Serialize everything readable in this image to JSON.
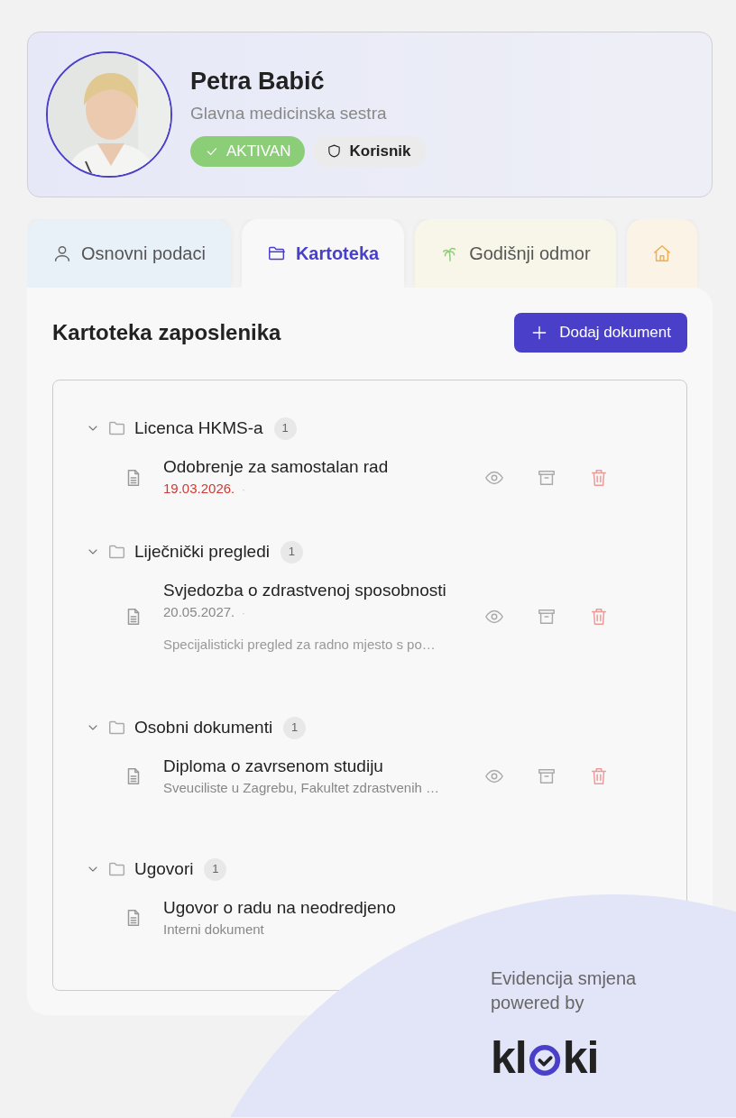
{
  "profile": {
    "name": "Petra Babić",
    "role": "Glavna medicinska sestra",
    "badges": [
      {
        "kind": "status",
        "label": "AKTIVAN"
      },
      {
        "kind": "role",
        "label": "Korisnik"
      }
    ]
  },
  "tabs": [
    {
      "kind": "person",
      "label": "Osnovni podaci",
      "selected": false,
      "color": "#e8f0f8"
    },
    {
      "kind": "folder",
      "label": "Kartoteka",
      "selected": true,
      "color": "#f8f8f8"
    },
    {
      "kind": "palm",
      "label": "Godišnji odmor",
      "selected": false,
      "color": "#f8f6e8"
    },
    {
      "kind": "house",
      "selected": false,
      "color": "#fbf4e6"
    }
  ],
  "panel": {
    "title": "Kartoteka zaposlenika",
    "add_button": "Dodaj dokument",
    "groups": [
      {
        "name": "Licenca HKMS-a",
        "count": "1",
        "expanded": true,
        "documents": [
          {
            "title": "Odobrenje za samostalan rad",
            "date": {
              "text": "19.03.2026.",
              "expired": true,
              "separator": "·"
            },
            "actions": true
          }
        ]
      },
      {
        "name": "Liječnički pregledi",
        "count": "1",
        "expanded": true,
        "documents": [
          {
            "title": "Svjedozba o zdrastvenoj sposobnosti",
            "date": {
              "text": "20.05.2027.",
              "expired": false,
              "separator": "·"
            },
            "description": "Specijalisticki pregled za radno mjesto s po…",
            "actions": true
          }
        ]
      },
      {
        "name": "Osobni dokumenti",
        "count": "1",
        "expanded": true,
        "documents": [
          {
            "title": "Diploma o zavrsenom studiju",
            "description": "Sveuciliste u Zagrebu, Fakultet zdrastvenih …",
            "actions": true
          }
        ]
      },
      {
        "name": "Ugovori",
        "count": "1",
        "expanded": true,
        "documents": [
          {
            "title": "Ugovor o radu na neodredjeno",
            "description": "Interni dokument",
            "actions": false
          }
        ]
      }
    ]
  },
  "footer": {
    "tagline": [
      "Evidencija smjena",
      "powered by"
    ],
    "logo": {
      "before": "kl",
      "after": "ki"
    }
  }
}
